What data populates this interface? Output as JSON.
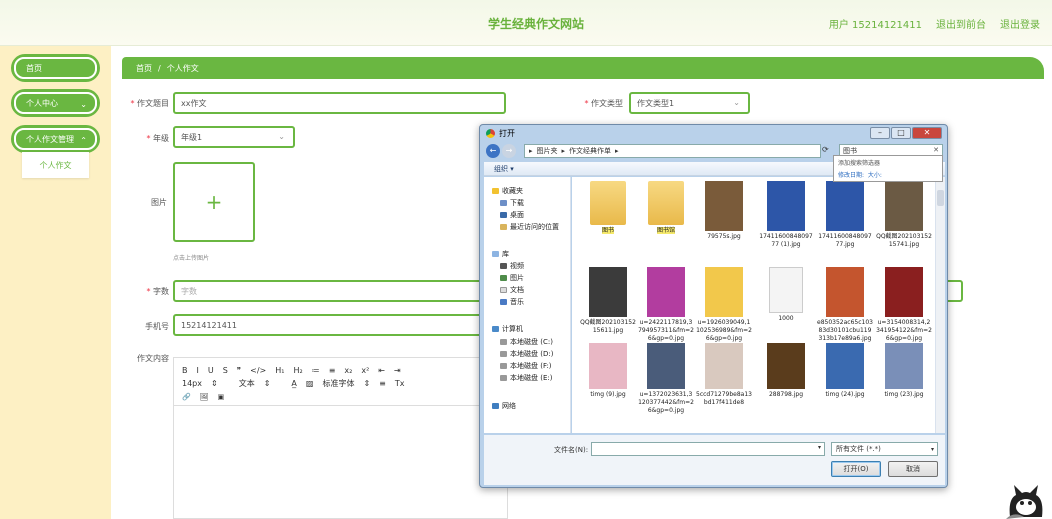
{
  "header": {
    "title": "学生经典作文网站",
    "user": "用户 15214121411",
    "back": "退出到前台",
    "logout": "退出登录"
  },
  "sidebar": {
    "items": [
      {
        "label": "首页"
      },
      {
        "label": "个人中心"
      },
      {
        "label": "个人作文管理"
      }
    ],
    "sub_item": "个人作文"
  },
  "breadcrumb": {
    "home": "首页",
    "sep": "/",
    "current": "个人作文"
  },
  "form": {
    "title_label": "作文题目",
    "title_value": "xx作文",
    "type_label": "作文类型",
    "type_value": "作文类型1",
    "grade_label": "年级",
    "grade_value": "年级1",
    "image_label": "图片",
    "upload_hint": "点击上传图片",
    "wordcount_label": "字数",
    "wordcount_placeholder": "字数",
    "phone_label": "手机号",
    "phone_value": "15214121411",
    "content_label": "作文内容"
  },
  "editor": {
    "row1": [
      "B",
      "I",
      "U",
      "S",
      "❞",
      "</>",
      "H₁",
      "H₂",
      "≔",
      "≡",
      "x₂",
      "x²",
      "⇤",
      "⇥"
    ],
    "fontsize": "14px",
    "text": "文本",
    "font": "标准字体",
    "row3": [
      "🔗",
      "🖼",
      "▣"
    ]
  },
  "dialog": {
    "title": "打开",
    "path": [
      "图片夹",
      "作文经典作单"
    ],
    "search": "图书",
    "suggest_title": "添加搜索筛选器",
    "suggest_modified": "修改日期:",
    "suggest_size": "大小:",
    "organize": "组织 ▾",
    "nav": {
      "fav": "收藏夹",
      "downloads": "下载",
      "desktop": "桌面",
      "recent": "最近访问的位置",
      "lib": "库",
      "video": "视频",
      "pictures": "图片",
      "docs": "文档",
      "music": "音乐",
      "computer": "计算机",
      "c": "本地磁盘 (C:)",
      "d": "本地磁盘 (D:)",
      "f": "本地磁盘 (F:)",
      "e": "本地磁盘 (E:)",
      "network": "网络"
    },
    "files": [
      {
        "name": "图书",
        "kind": "folder-hl"
      },
      {
        "name": "图书馆",
        "kind": "folder-hl"
      },
      {
        "name": "79575s.jpg",
        "kind": "img",
        "color": "#7a5b3a"
      },
      {
        "name": "1741160084809777 (1).jpg",
        "kind": "img",
        "color": "#2d56a8"
      },
      {
        "name": "1741160084809777.jpg",
        "kind": "img",
        "color": "#2d56a8"
      },
      {
        "name": "QQ截图20210315215741.jpg",
        "kind": "img",
        "color": "#6b5a44"
      },
      {
        "name": "QQ截图20210315215611.jpg",
        "kind": "img",
        "color": "#3b3b3b"
      },
      {
        "name": "u=2422117819,3794957311&fm=26&gp=0.jpg",
        "kind": "img",
        "color": "#b23d9f"
      },
      {
        "name": "u=1926039049,1102536989&fm=26&gp=0.jpg",
        "kind": "img",
        "color": "#f2c84b"
      },
      {
        "name": "1000",
        "kind": "doc"
      },
      {
        "name": "e850352ac65c10383d30101cbu119313b17e89a6.jpg",
        "kind": "img",
        "color": "#c4552e"
      },
      {
        "name": "u=3154008314,2341954122&fm=26&gp=0.jpg",
        "kind": "img",
        "color": "#8a1f1f"
      },
      {
        "name": "timg (9).jpg",
        "kind": "img",
        "color": "#e8b7c4"
      },
      {
        "name": "u=1372023631,3120377442&fm=26&gp=0.jpg",
        "kind": "img",
        "color": "#4a5c7a"
      },
      {
        "name": "5ccd71279be8a13bd17f411de8",
        "kind": "img",
        "color": "#d9c9bf"
      },
      {
        "name": "288798.jpg",
        "kind": "img",
        "color": "#5a3c1c"
      },
      {
        "name": "timg (24).jpg",
        "kind": "img",
        "color": "#3a6ab0"
      },
      {
        "name": "timg (23).jpg",
        "kind": "img",
        "color": "#7a8fb8"
      }
    ],
    "filename_label": "文件名(N):",
    "filetype": "所有文件 (*.*)",
    "open": "打开(O)",
    "cancel": "取消"
  }
}
